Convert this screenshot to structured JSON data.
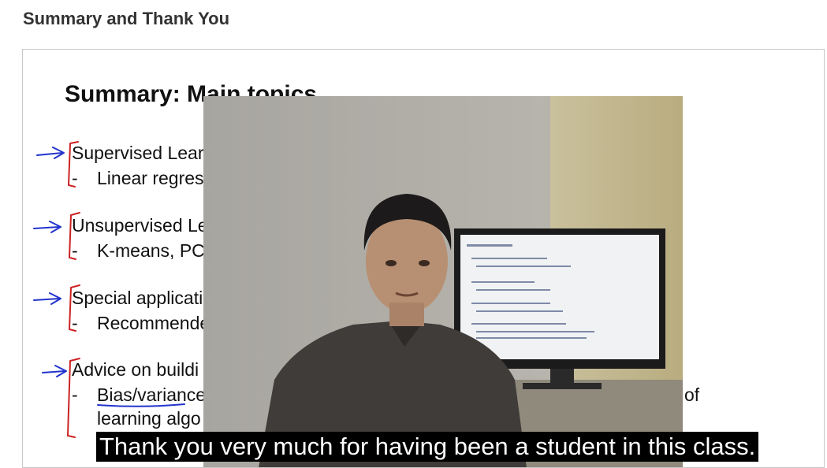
{
  "page": {
    "title": "Summary and Thank You"
  },
  "slide": {
    "heading": "Summary: Main topics",
    "topics": [
      {
        "label": "Supervised Learning",
        "visible_label": "Supervised Learr",
        "sub": "Linear regres"
      },
      {
        "label": "Unsupervised Learning",
        "visible_label": "Unsupervised Le",
        "sub": "K-means, PCA"
      },
      {
        "label": "Special applications",
        "visible_label": "Special applicati",
        "sub": "Recommende"
      },
      {
        "label": "Advice on building",
        "visible_label": "Advice on buildi",
        "sub": "Bias/variance",
        "sub2": "learning algo",
        "trailing": "of"
      }
    ]
  },
  "video": {
    "caption": "Thank you very much for having been a student in this class."
  },
  "colors": {
    "annotation_blue": "#2233cc",
    "annotation_red": "#cc2222",
    "caption_bg": "#000000"
  }
}
